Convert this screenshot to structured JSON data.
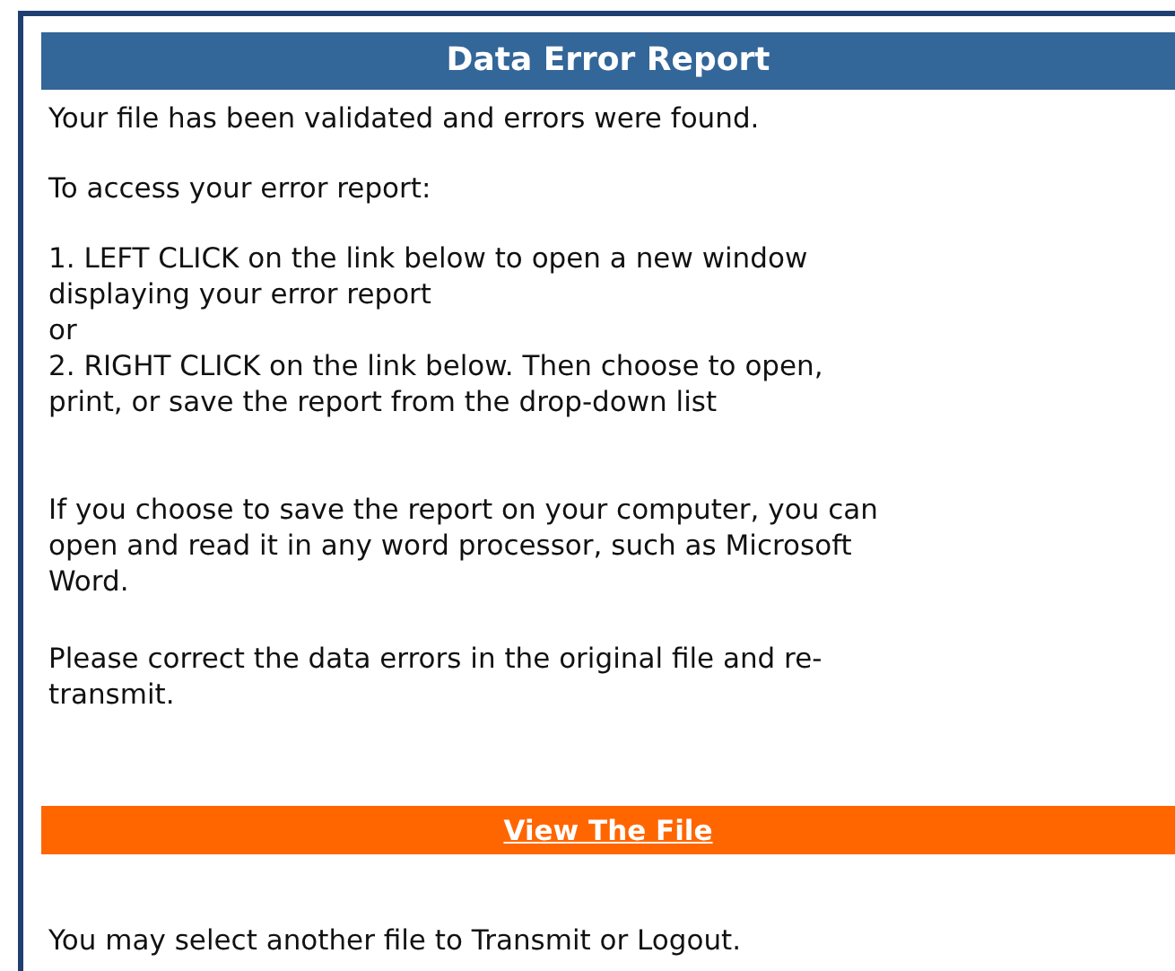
{
  "title": "Data Error Report",
  "paragraphs": [
    {
      "lines": [
        "Your file has been validated and errors were found."
      ]
    },
    {
      "lines": [
        "To access your error report:"
      ]
    },
    {
      "lines": [
        "1. LEFT CLICK on the link below to open a new window",
        "displaying your error report",
        "or",
        "2. RIGHT CLICK on the link below. Then choose to open,",
        "print, or save the report from the drop-down list"
      ]
    },
    {
      "lines": [
        "If you choose to save the report on your computer, you can",
        "open and read it in any word processor, such as Microsoft",
        "Word."
      ]
    },
    {
      "lines": [
        "Please correct the data errors in the original file and re-",
        "transmit."
      ]
    }
  ],
  "link": "View The File",
  "footer": "You may select another file to Transmit or Logout."
}
